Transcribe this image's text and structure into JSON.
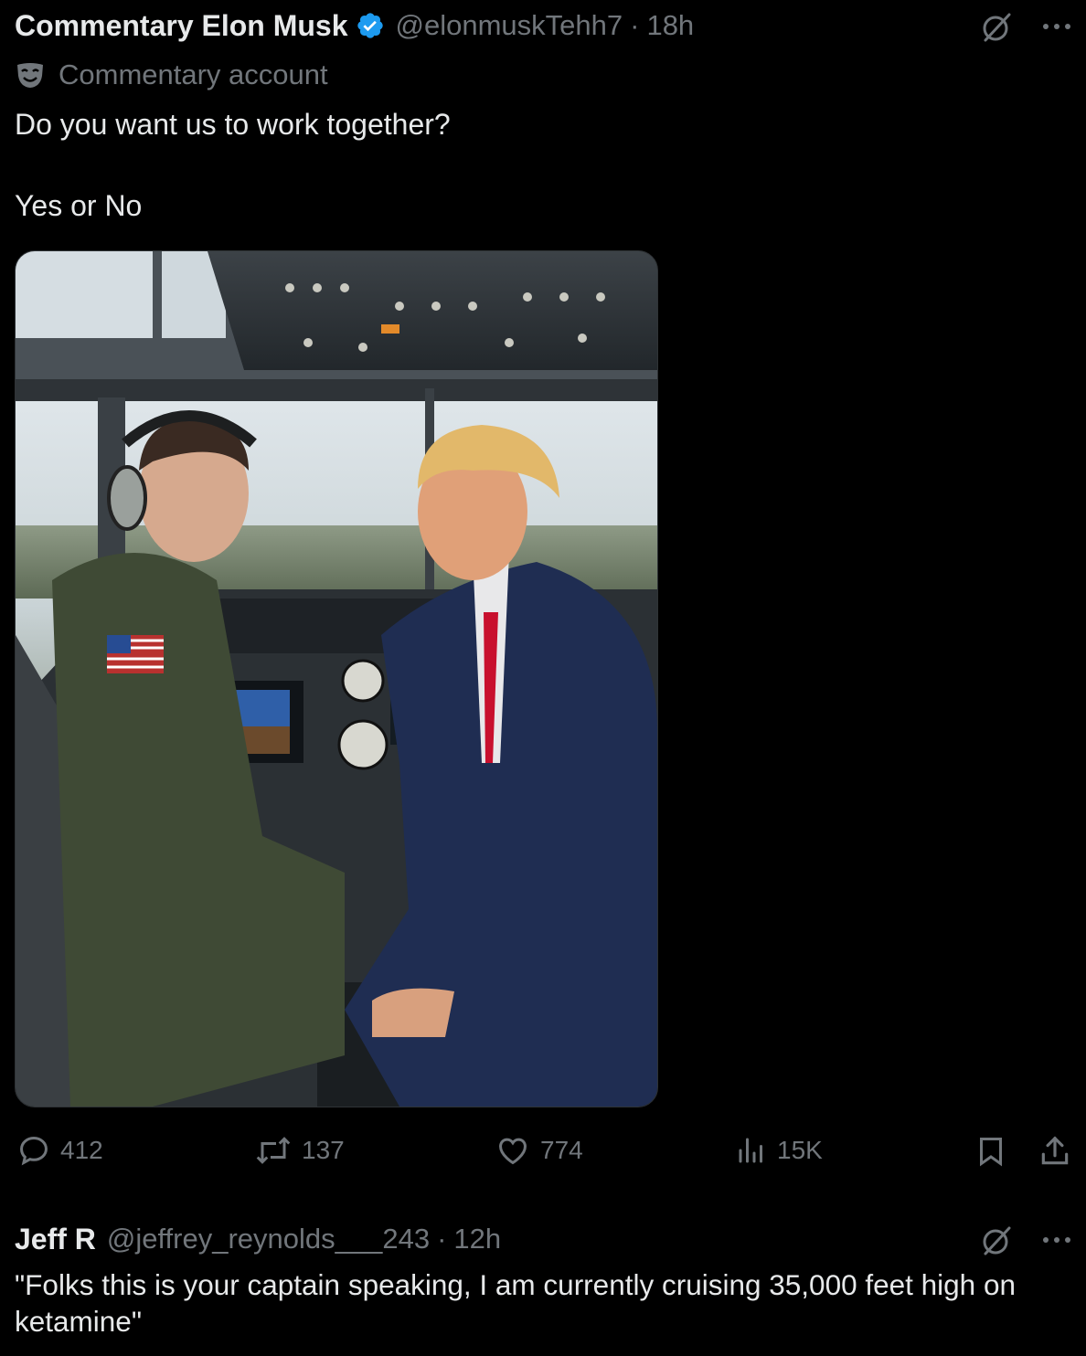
{
  "tweet": {
    "author_name": "Commentary Elon Musk",
    "handle": "@elonmuskTehh7",
    "separator": "·",
    "time": "18h",
    "label_text": "Commentary account",
    "text_line1": "Do you want us to work together?",
    "text_line2": "Yes or No",
    "image_alt": "Photo of two men in an airliner cockpit",
    "actions": {
      "reply_count": "412",
      "retweet_count": "137",
      "like_count": "774",
      "views_count": "15K"
    }
  },
  "reply": {
    "author_name": "Jeff R",
    "handle": "@jeffrey_reynolds___243",
    "separator": "·",
    "time": "12h",
    "text": "\"Folks this is your captain speaking, I am currently cruising 35,000 feet high on ketamine\""
  },
  "colors": {
    "background": "#000000",
    "text": "#e7e9ea",
    "muted": "#71767b",
    "verified": "#1d9bf0"
  },
  "icons": [
    "verified-badge-icon",
    "grok-icon",
    "more-icon",
    "commentary-mask-icon",
    "reply-icon",
    "retweet-icon",
    "like-icon",
    "views-icon",
    "bookmark-icon",
    "share-icon"
  ]
}
